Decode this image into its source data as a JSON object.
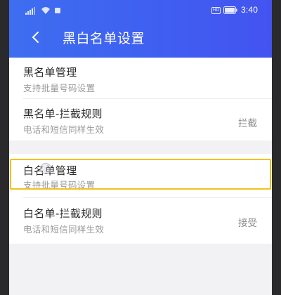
{
  "status_bar": {
    "time": "3:40",
    "hd_label": "HD",
    "icons": [
      "signal-icon",
      "wifi-icon",
      "notification-icon",
      "battery-icon"
    ]
  },
  "header": {
    "back_icon": "chevron-left-icon",
    "title": "黑白名单设置"
  },
  "blacklist_group": {
    "manage": {
      "title": "黑名单管理",
      "subtitle": "支持批量号码设置"
    },
    "rules": {
      "title": "黑名单-拦截规则",
      "subtitle": "电话和短信同样生效",
      "value": "拦截"
    }
  },
  "whitelist_group": {
    "manage": {
      "title": "白名单管理",
      "subtitle": "支持批量号码设置"
    },
    "rules": {
      "title": "白名单-拦截规则",
      "subtitle": "电话和短信同样生效",
      "value": "接受"
    }
  },
  "colors": {
    "header_gradient_start": "#3e6ff0",
    "header_gradient_end": "#4452f0",
    "highlight": "#f2c21a",
    "background": "#f2f2f4"
  }
}
